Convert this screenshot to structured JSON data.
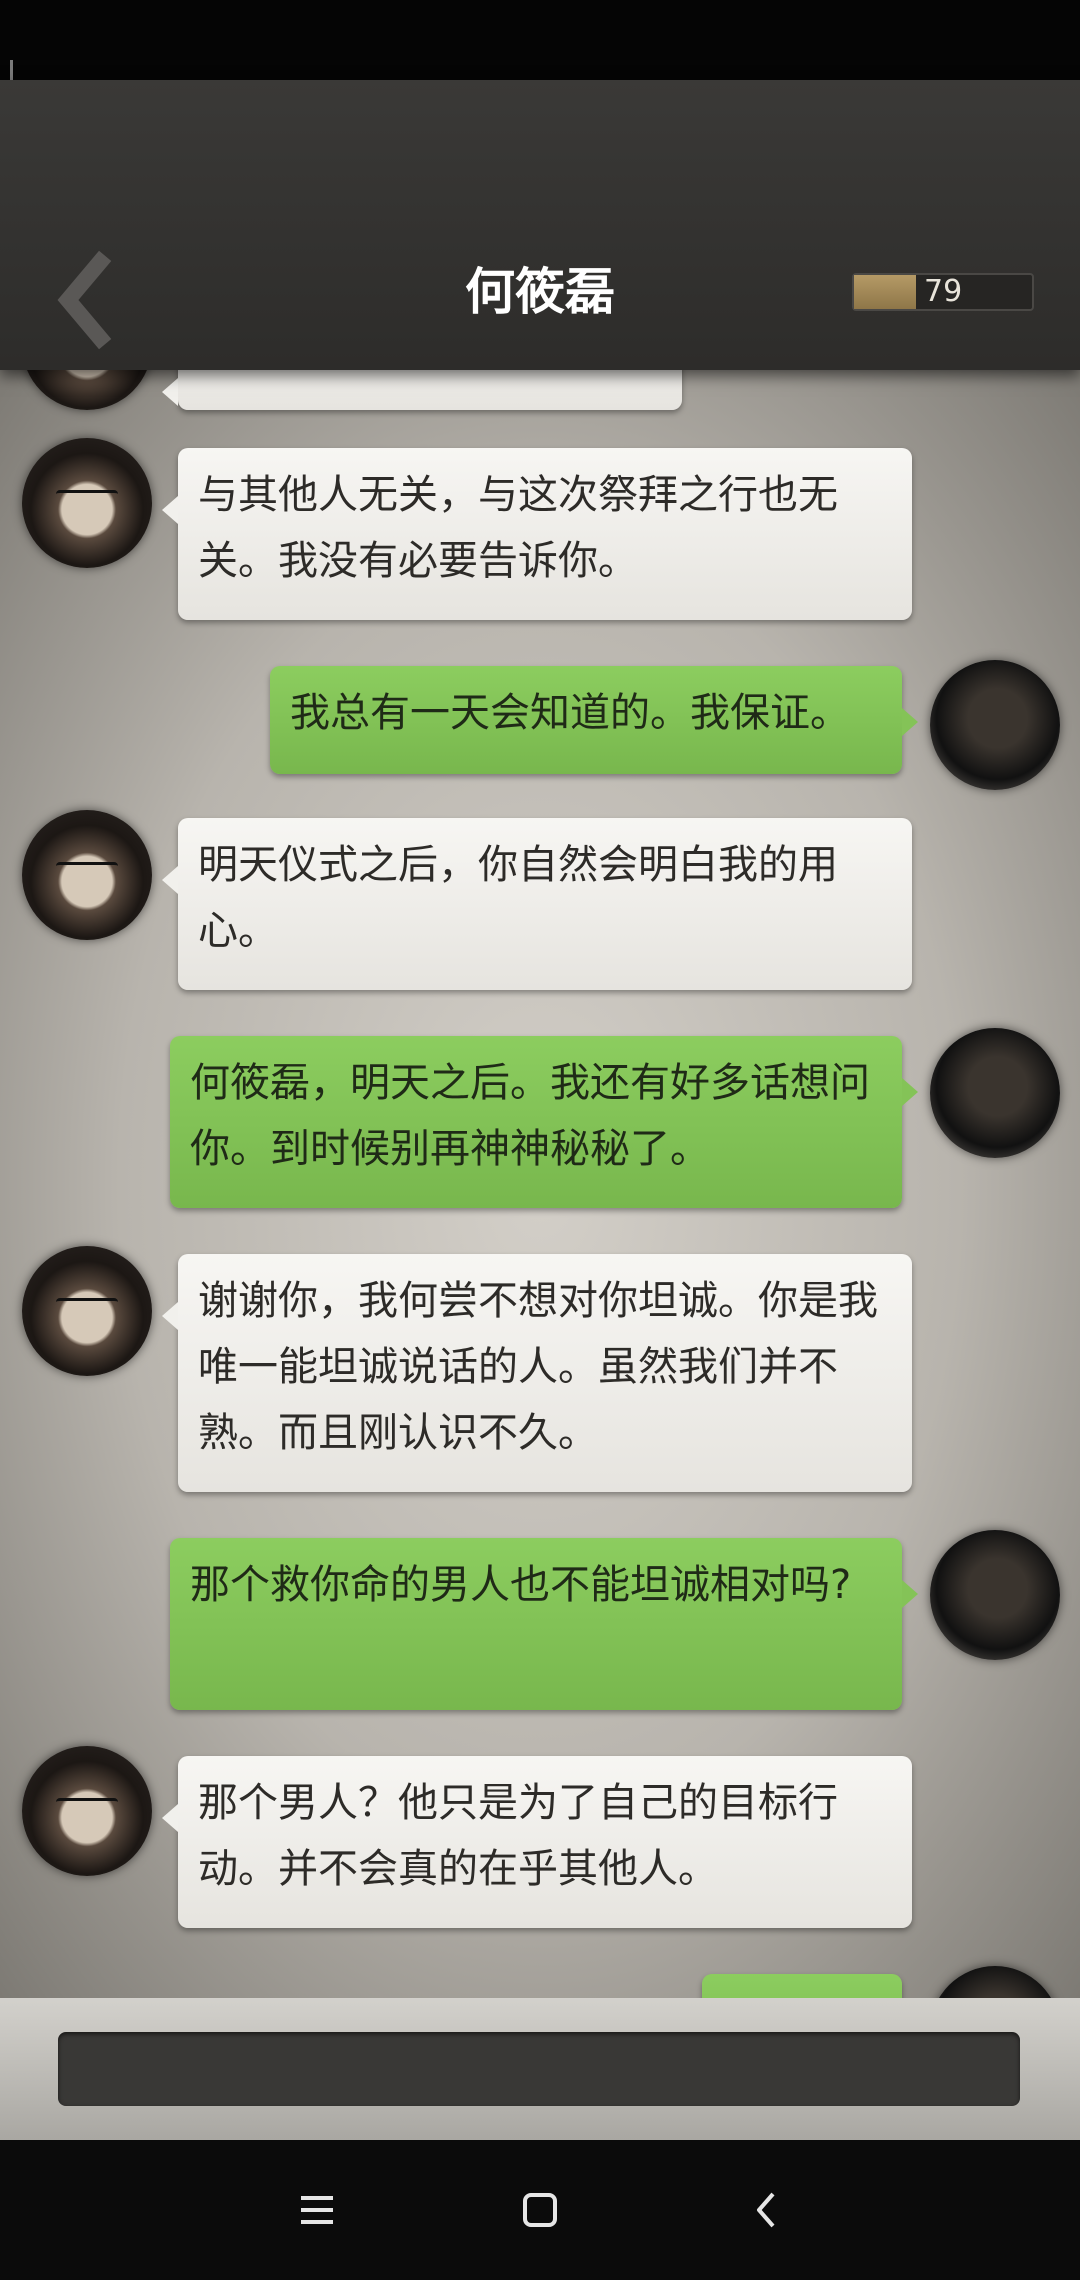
{
  "header": {
    "title": "何筱磊",
    "progress_value": "79",
    "progress_fraction": 0.35
  },
  "messages": [
    {
      "sender": "other",
      "text": ""
    },
    {
      "sender": "other",
      "text": "与其他人无关，与这次祭拜之行也无关。我没有必要告诉你。"
    },
    {
      "sender": "me",
      "text": "我总有一天会知道的。我保证。"
    },
    {
      "sender": "other",
      "text": "明天仪式之后，你自然会明白我的用心。"
    },
    {
      "sender": "me",
      "text": "何筱磊，明天之后。我还有好多话想问你。到时候别再神神秘秘了。"
    },
    {
      "sender": "other",
      "text": "谢谢你，我何尝不想对你坦诚。你是我唯一能坦诚说话的人。虽然我们并不熟。而且刚认识不久。"
    },
    {
      "sender": "me",
      "text": "那个救你命的男人也不能坦诚相对吗?"
    },
    {
      "sender": "other",
      "text": "那个男人？他只是为了自己的目标行动。并不会真的在乎其他人。"
    },
    {
      "sender": "me",
      "text": ""
    }
  ],
  "input": {
    "value": ""
  },
  "nav": {
    "icons": [
      "menu-icon",
      "home-square-icon",
      "back-chevron-icon"
    ]
  },
  "colors": {
    "my_bubble": "#84c357",
    "other_bubble": "#f1f0ec",
    "header": "#2e2d2b"
  }
}
